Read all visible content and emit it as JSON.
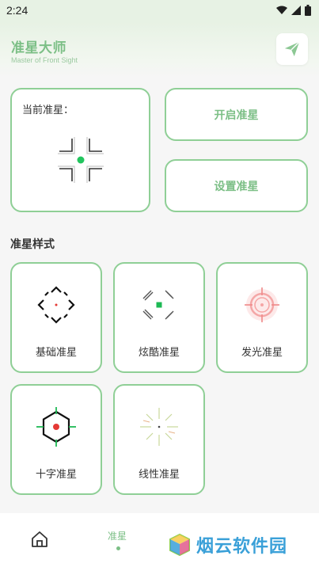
{
  "status_bar": {
    "time": "2:24"
  },
  "header": {
    "title": "准星大师",
    "subtitle": "Master of Front Sight",
    "share_icon": "paper-plane-icon"
  },
  "current": {
    "label": "当前准星："
  },
  "actions": {
    "open_label": "开启准星",
    "set_label": "设置准星"
  },
  "styles": {
    "section_title": "准星样式",
    "items": [
      {
        "label": "基础准星",
        "icon": "basic-crosshair-icon"
      },
      {
        "label": "炫酷准星",
        "icon": "cool-crosshair-icon"
      },
      {
        "label": "发光准星",
        "icon": "glow-crosshair-icon"
      },
      {
        "label": "十字准星",
        "icon": "cross-crosshair-icon"
      },
      {
        "label": "线性准星",
        "icon": "linear-crosshair-icon"
      }
    ]
  },
  "bottom_nav": {
    "home_icon": "home-icon",
    "tab_label": "准星"
  },
  "watermark": {
    "text": "烟云软件园"
  },
  "colors": {
    "accent": "#7cbf86",
    "border": "#8fcf96",
    "crosshair_dot": "#22c55e",
    "glow": "#f08a8a",
    "watermark": "#3aa0d8"
  }
}
